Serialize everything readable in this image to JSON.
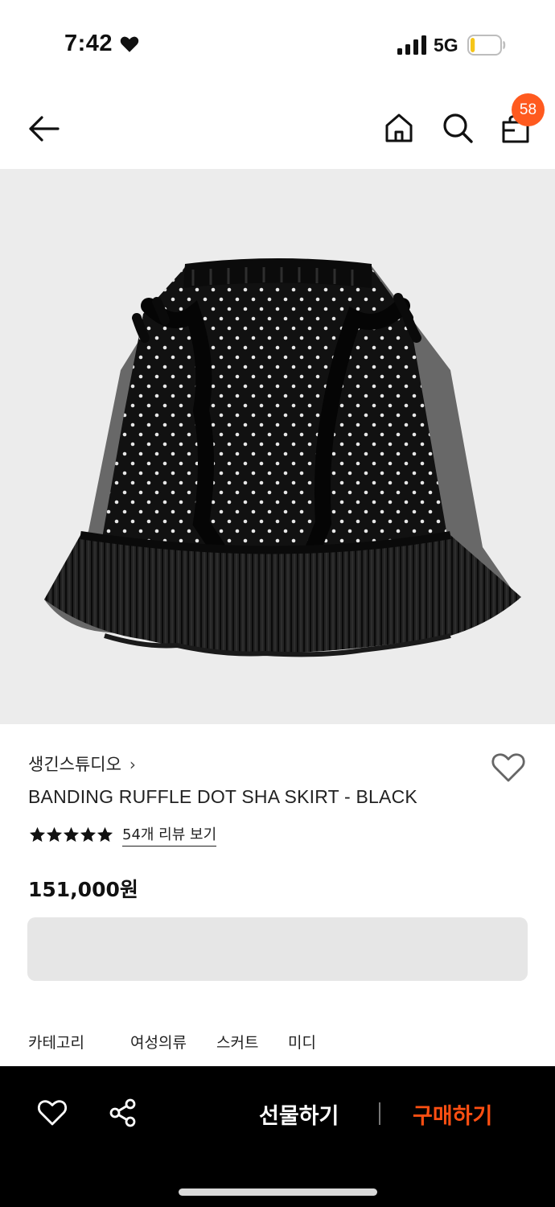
{
  "status_bar": {
    "time": "7:42",
    "network": "5G",
    "battery_level": 0.15,
    "battery_color": "#f5c518"
  },
  "header": {
    "cart_count": "58",
    "badge_color": "#ff5a1f"
  },
  "product": {
    "brand": "생긴스튜디오",
    "brand_chevron": "›",
    "name": "BANDING RUFFLE DOT SHA SKIRT - BLACK",
    "rating": 5,
    "rating_max": 5,
    "review_link": "54개 리뷰 보기",
    "price": "151,000원"
  },
  "categories": {
    "label": "카테고리",
    "items": [
      "여성의류",
      "스커트",
      "미디"
    ]
  },
  "bottom_bar": {
    "gift_label": "선물하기",
    "buy_label": "구매하기",
    "buy_color": "#ff4f12"
  },
  "icons": [
    "heart-icon",
    "signal-icon",
    "battery-icon",
    "back-arrow-icon",
    "home-icon",
    "search-icon",
    "shopping-bag-icon",
    "wishlist-heart-icon",
    "star-icon",
    "share-icon"
  ]
}
